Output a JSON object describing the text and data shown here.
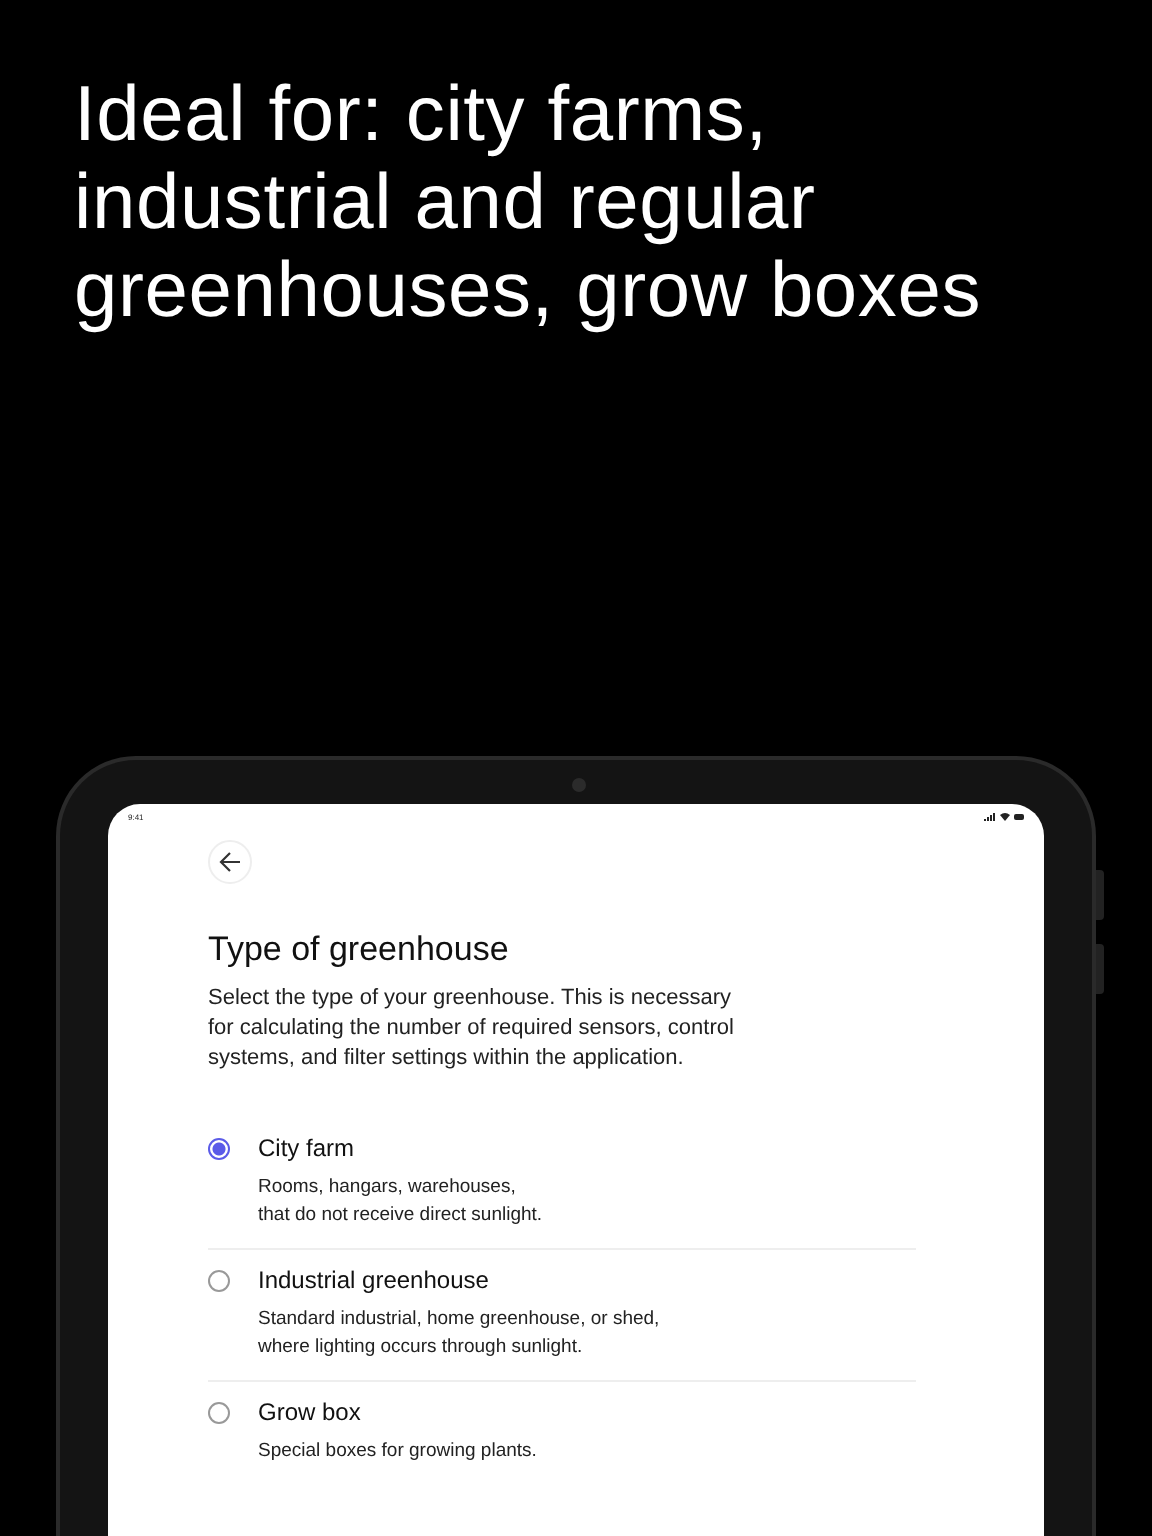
{
  "headline": [
    "Ideal for: city farms,",
    "industrial and regular",
    "greenhouses, grow boxes"
  ],
  "status_bar": {
    "time": "9:41"
  },
  "screen": {
    "title": "Type of greenhouse",
    "description": [
      "Select the type of your greenhouse. This is necessary",
      "for calculating the number of required sensors, control",
      "systems, and filter settings within the application."
    ],
    "options": [
      {
        "label": "City farm",
        "details": [
          "Rooms, hangars, warehouses,",
          "that do not receive direct sunlight."
        ],
        "selected": true
      },
      {
        "label": "Industrial greenhouse",
        "details": [
          "Standard industrial, home greenhouse, or shed,",
          "where lighting occurs through sunlight."
        ],
        "selected": false
      },
      {
        "label": "Grow box",
        "details": [
          "Special boxes for growing plants."
        ],
        "selected": false
      }
    ]
  }
}
